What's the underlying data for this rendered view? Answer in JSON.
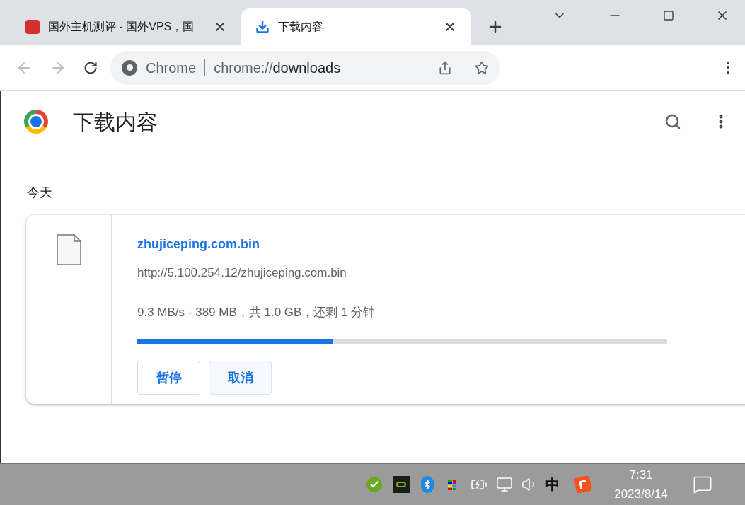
{
  "tabs": [
    {
      "title": "国外主机测评 - 国外VPS，国",
      "kind": "site",
      "selected": false
    },
    {
      "title": "下载内容",
      "kind": "download",
      "selected": true
    }
  ],
  "address_bar": {
    "site_label": "Chrome",
    "url_prefix": "chrome://",
    "url_path": "downloads"
  },
  "page": {
    "title": "下载内容",
    "date_group": "今天"
  },
  "download": {
    "file_name": "zhujiceping.com.bin",
    "url": "http://5.100.254.12/zhujiceping.com.bin",
    "status": "9.3 MB/s - 389 MB，共 1.0 GB，还剩 1 分钟",
    "level": 0.37,
    "buttons": [
      "暂停",
      "取消"
    ]
  },
  "taskbar": {
    "ime": "中",
    "time": "7:31",
    "date": "2023/8/14"
  }
}
